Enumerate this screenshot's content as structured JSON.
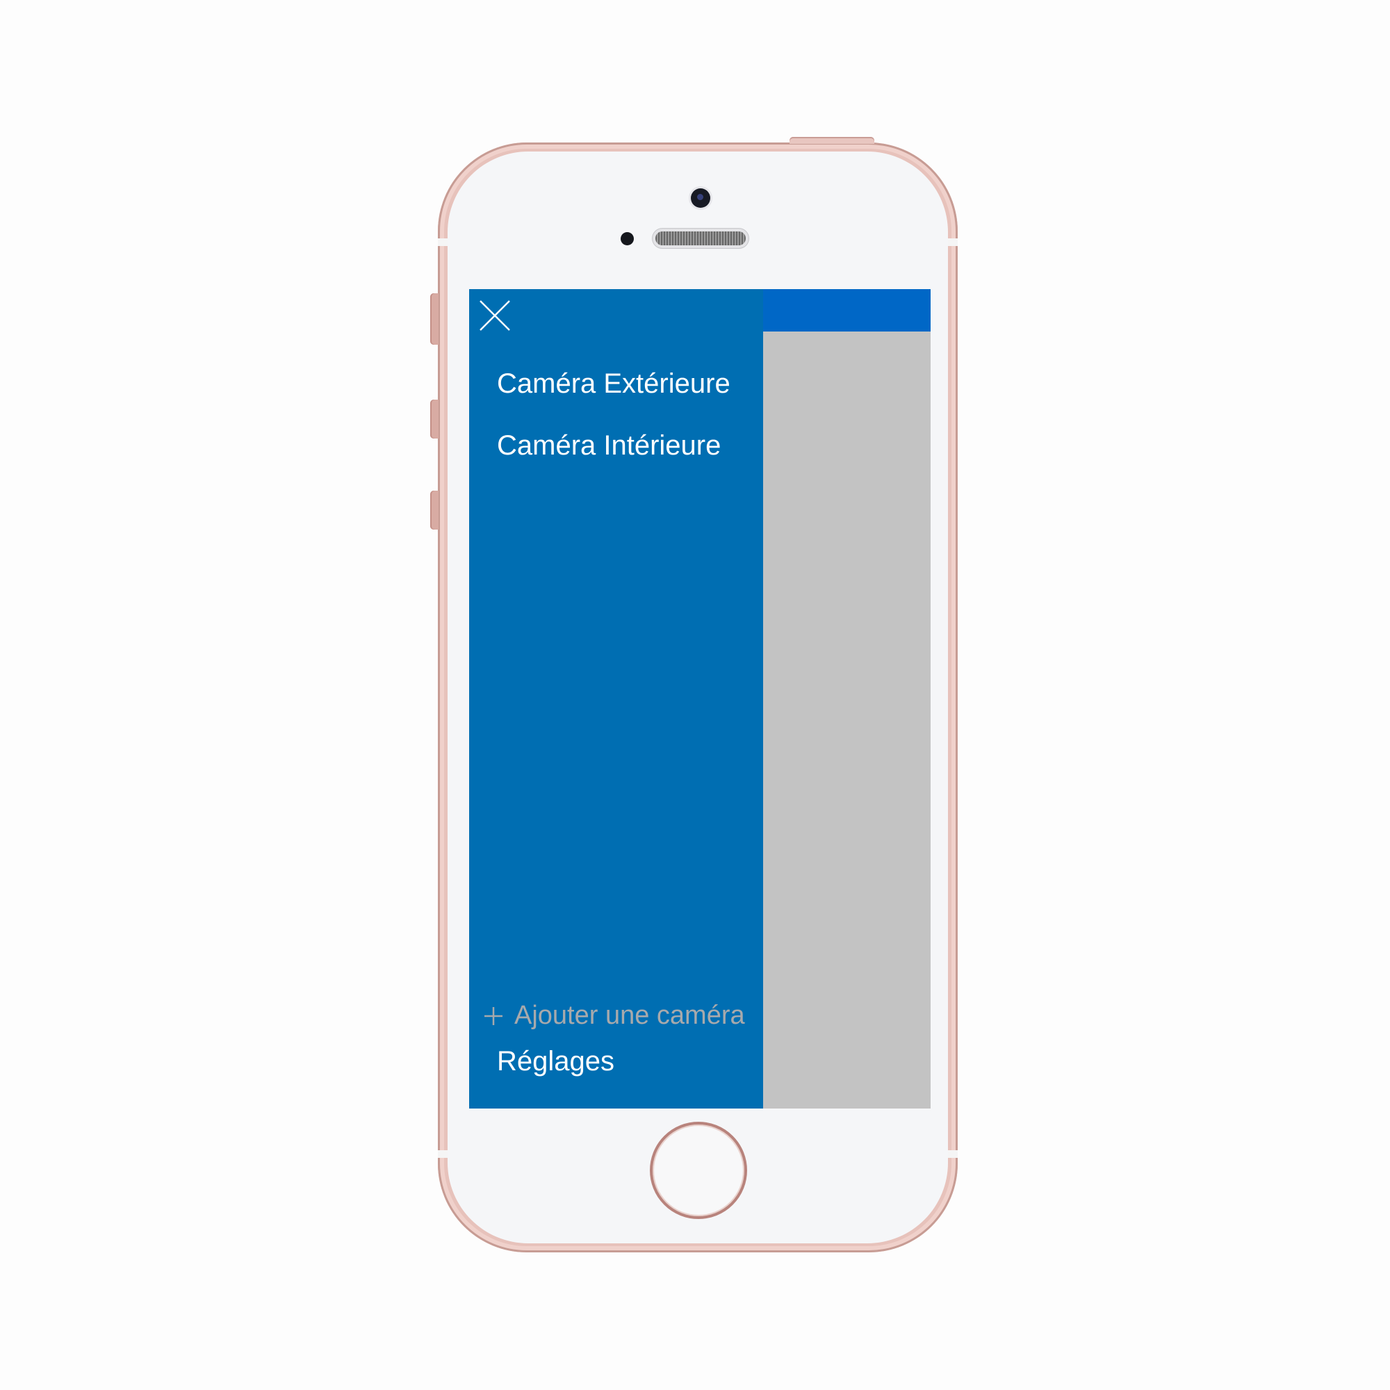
{
  "drawer": {
    "close_icon": "close-icon",
    "camera_items": [
      {
        "label": "Caméra Extérieure"
      },
      {
        "label": "Caméra Intérieure"
      }
    ],
    "add_camera": {
      "icon": "plus-icon",
      "label": "Ajouter une caméra"
    },
    "settings_label": "Réglages"
  },
  "colors": {
    "drawer_background": "#006eb2",
    "top_bar": "#0067c6",
    "overlay": "#c3c3c3",
    "menu_text": "#ffffff",
    "muted_text": "#a7a9ac",
    "phone_frame": "#e7c2bb"
  }
}
